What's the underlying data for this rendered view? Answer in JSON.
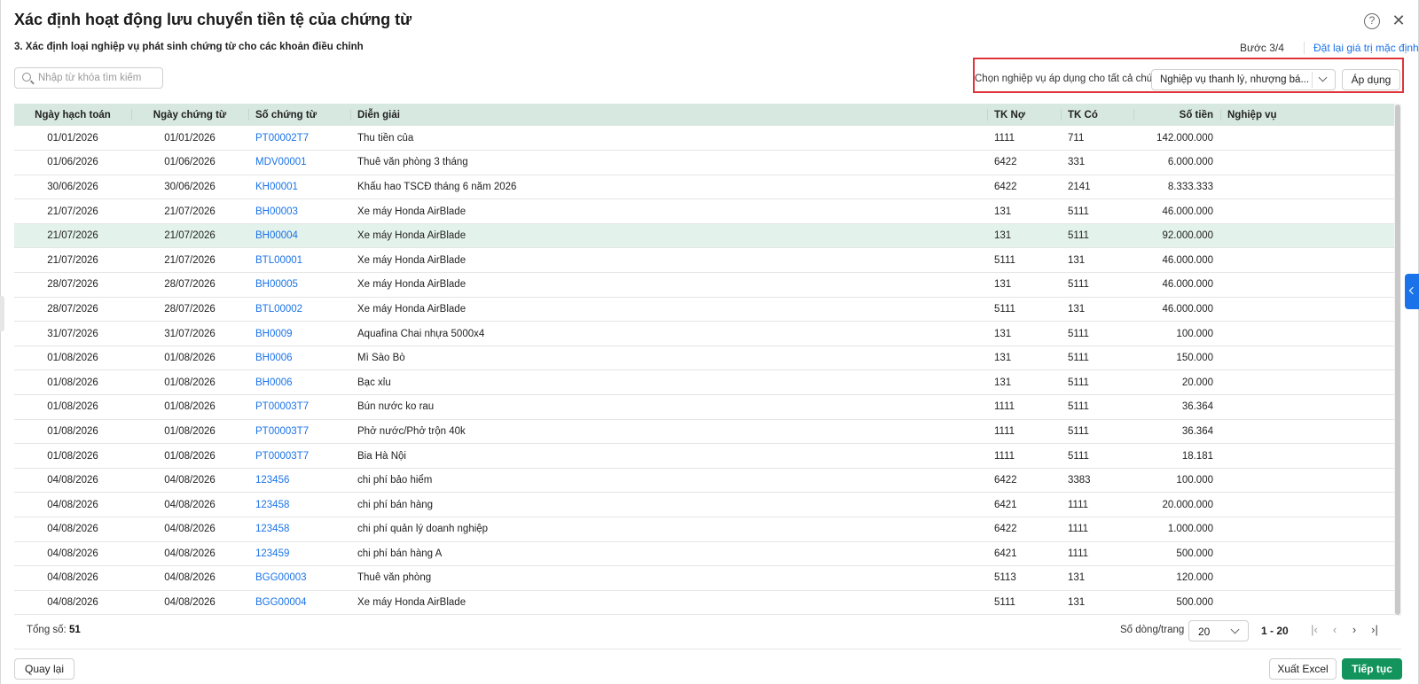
{
  "dialog": {
    "title": "Xác định hoạt động lưu chuyển tiền tệ của chứng từ",
    "subtitle": "3. Xác định loại nghiệp vụ phát sinh chứng từ cho các khoản điều chỉnh",
    "step": "Bước 3/4",
    "reset_link": "Đặt lại giá trị mặc định",
    "help_icon_glyph": "?",
    "close_icon_glyph": "✕"
  },
  "search": {
    "placeholder": "Nhập từ khóa tìm kiếm",
    "value": ""
  },
  "apply_panel": {
    "label": "Chọn nghiệp vụ áp dụng cho tất cả chứng từ",
    "selected": "Nghiệp vụ thanh lý, nhượng bá...",
    "apply_button": "Áp dụng",
    "highlight_color": "#e0343a"
  },
  "table": {
    "columns": [
      "Ngày hạch toán",
      "Ngày chứng từ",
      "Số chứng từ",
      "Diễn giải",
      "TK Nợ",
      "TK Có",
      "Số tiền",
      "Nghiệp vụ"
    ],
    "selected_row_index": 4,
    "rows": [
      [
        "01/01/2026",
        "01/01/2026",
        "PT00002T7",
        "Thu tiền của",
        "1111",
        "711",
        "142.000.000",
        ""
      ],
      [
        "01/06/2026",
        "01/06/2026",
        "MDV00001",
        "Thuê văn phòng 3 tháng",
        "6422",
        "331",
        "6.000.000",
        ""
      ],
      [
        "30/06/2026",
        "30/06/2026",
        "KH00001",
        "Khấu hao TSCĐ tháng 6 năm 2026",
        "6422",
        "2141",
        "8.333.333",
        ""
      ],
      [
        "21/07/2026",
        "21/07/2026",
        "BH00003",
        "Xe máy Honda AirBlade",
        "131",
        "5111",
        "46.000.000",
        ""
      ],
      [
        "21/07/2026",
        "21/07/2026",
        "BH00004",
        "Xe máy Honda AirBlade",
        "131",
        "5111",
        "92.000.000",
        ""
      ],
      [
        "21/07/2026",
        "21/07/2026",
        "BTL00001",
        "Xe máy Honda AirBlade",
        "5111",
        "131",
        "46.000.000",
        ""
      ],
      [
        "28/07/2026",
        "28/07/2026",
        "BH00005",
        "Xe máy Honda AirBlade",
        "131",
        "5111",
        "46.000.000",
        ""
      ],
      [
        "28/07/2026",
        "28/07/2026",
        "BTL00002",
        "Xe máy Honda AirBlade",
        "5111",
        "131",
        "46.000.000",
        ""
      ],
      [
        "31/07/2026",
        "31/07/2026",
        "BH0009",
        "Aquafina Chai nhựa 5000x4",
        "131",
        "5111",
        "100.000",
        ""
      ],
      [
        "01/08/2026",
        "01/08/2026",
        "BH0006",
        "Mì Sào Bò",
        "131",
        "5111",
        "150.000",
        ""
      ],
      [
        "01/08/2026",
        "01/08/2026",
        "BH0006",
        "Bạc xỉu",
        "131",
        "5111",
        "20.000",
        ""
      ],
      [
        "01/08/2026",
        "01/08/2026",
        "PT00003T7",
        "Bún nước ko rau",
        "1111",
        "5111",
        "36.364",
        ""
      ],
      [
        "01/08/2026",
        "01/08/2026",
        "PT00003T7",
        "Phở nước/Phở trộn 40k",
        "1111",
        "5111",
        "36.364",
        ""
      ],
      [
        "01/08/2026",
        "01/08/2026",
        "PT00003T7",
        "Bia Hà Nội",
        "1111",
        "5111",
        "18.181",
        ""
      ],
      [
        "04/08/2026",
        "04/08/2026",
        "123456",
        "chi phí bảo hiểm",
        "6422",
        "3383",
        "100.000",
        ""
      ],
      [
        "04/08/2026",
        "04/08/2026",
        "123458",
        "chi phí bán hàng",
        "6421",
        "1111",
        "20.000.000",
        ""
      ],
      [
        "04/08/2026",
        "04/08/2026",
        "123458",
        "chi phí quản lý doanh nghiệp",
        "6422",
        "1111",
        "1.000.000",
        ""
      ],
      [
        "04/08/2026",
        "04/08/2026",
        "123459",
        "chi phí bán hàng A",
        "6421",
        "1111",
        "500.000",
        ""
      ],
      [
        "04/08/2026",
        "04/08/2026",
        "BGG00003",
        "Thuê văn phòng",
        "5113",
        "131",
        "120.000",
        ""
      ],
      [
        "04/08/2026",
        "04/08/2026",
        "BGG00004",
        "Xe máy Honda AirBlade",
        "5111",
        "131",
        "500.000",
        ""
      ]
    ]
  },
  "footer": {
    "total_label": "Tổng số:",
    "total_value": "51",
    "rows_per_page_label": "Số dòng/trang",
    "rows_per_page": "20",
    "page_range": "1 - 20",
    "first_page_glyph": "|‹",
    "prev_page_glyph": "‹",
    "next_page_glyph": "›",
    "last_page_glyph": "›|",
    "back_button": "Quay lại",
    "export_button": "Xuất Excel",
    "continue_button": "Tiếp tục"
  },
  "colors": {
    "accent": "#1a73e8",
    "primary_button": "#12945c",
    "header_bg": "#d7e8e1",
    "selected_row_bg": "#e4f2ec"
  }
}
